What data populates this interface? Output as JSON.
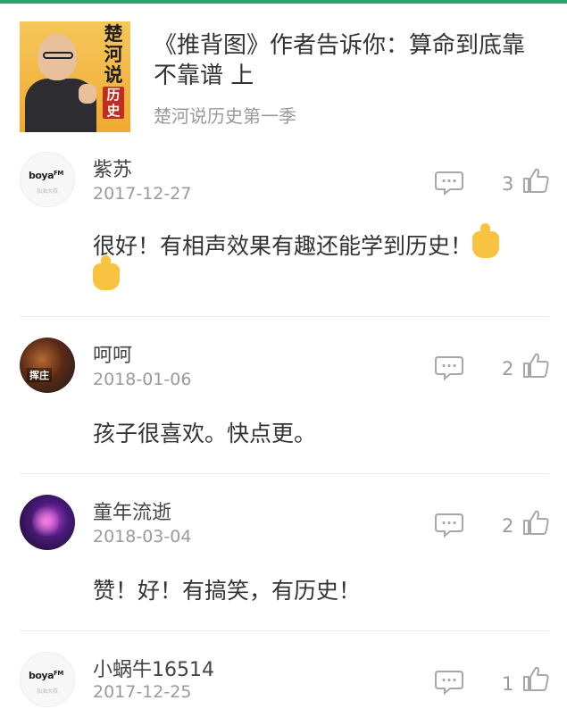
{
  "header": {
    "cover_title": [
      "楚",
      "河",
      "说",
      "历",
      "史"
    ],
    "episode_title": "《推背图》作者告诉你：算命到底靠不靠谱 上",
    "album_name": "楚河说历史第一季"
  },
  "comments": [
    {
      "username": "紫苏",
      "date": "2017-12-27",
      "likes": "3",
      "text": "很好！有相声效果有趣还能学到历史！",
      "emoji": [
        "thumbs-up",
        "thumbs-up"
      ],
      "avatar": "boya-fm-default-avatar",
      "avatar_text": {
        "brand": "boya",
        "fm": "FM",
        "sub": "加油大叔"
      }
    },
    {
      "username": "呵呵",
      "date": "2018-01-06",
      "likes": "2",
      "text": "孩子很喜欢。快点更。",
      "avatar": "game-character-avatar",
      "avatar_text": {
        "label": "挥庄"
      }
    },
    {
      "username": "童年流逝",
      "date": "2018-03-04",
      "likes": "2",
      "text": "赞！好！有搞笑，有历史！",
      "avatar": "purple-dragon-avatar"
    },
    {
      "username": "小蜗牛16514",
      "date": "2017-12-25",
      "likes": "1",
      "text": "",
      "avatar": "boya-fm-default-avatar",
      "avatar_text": {
        "brand": "boya",
        "fm": "FM",
        "sub": "加油大叔"
      }
    }
  ],
  "icons": {
    "reply": "speech-bubble-icon",
    "like": "thumbs-up-outline-icon"
  },
  "colors": {
    "accent": "#27a36b",
    "text_primary": "#333333",
    "text_secondary": "#9a9a9a",
    "icon_gray": "#a7a7a7"
  }
}
